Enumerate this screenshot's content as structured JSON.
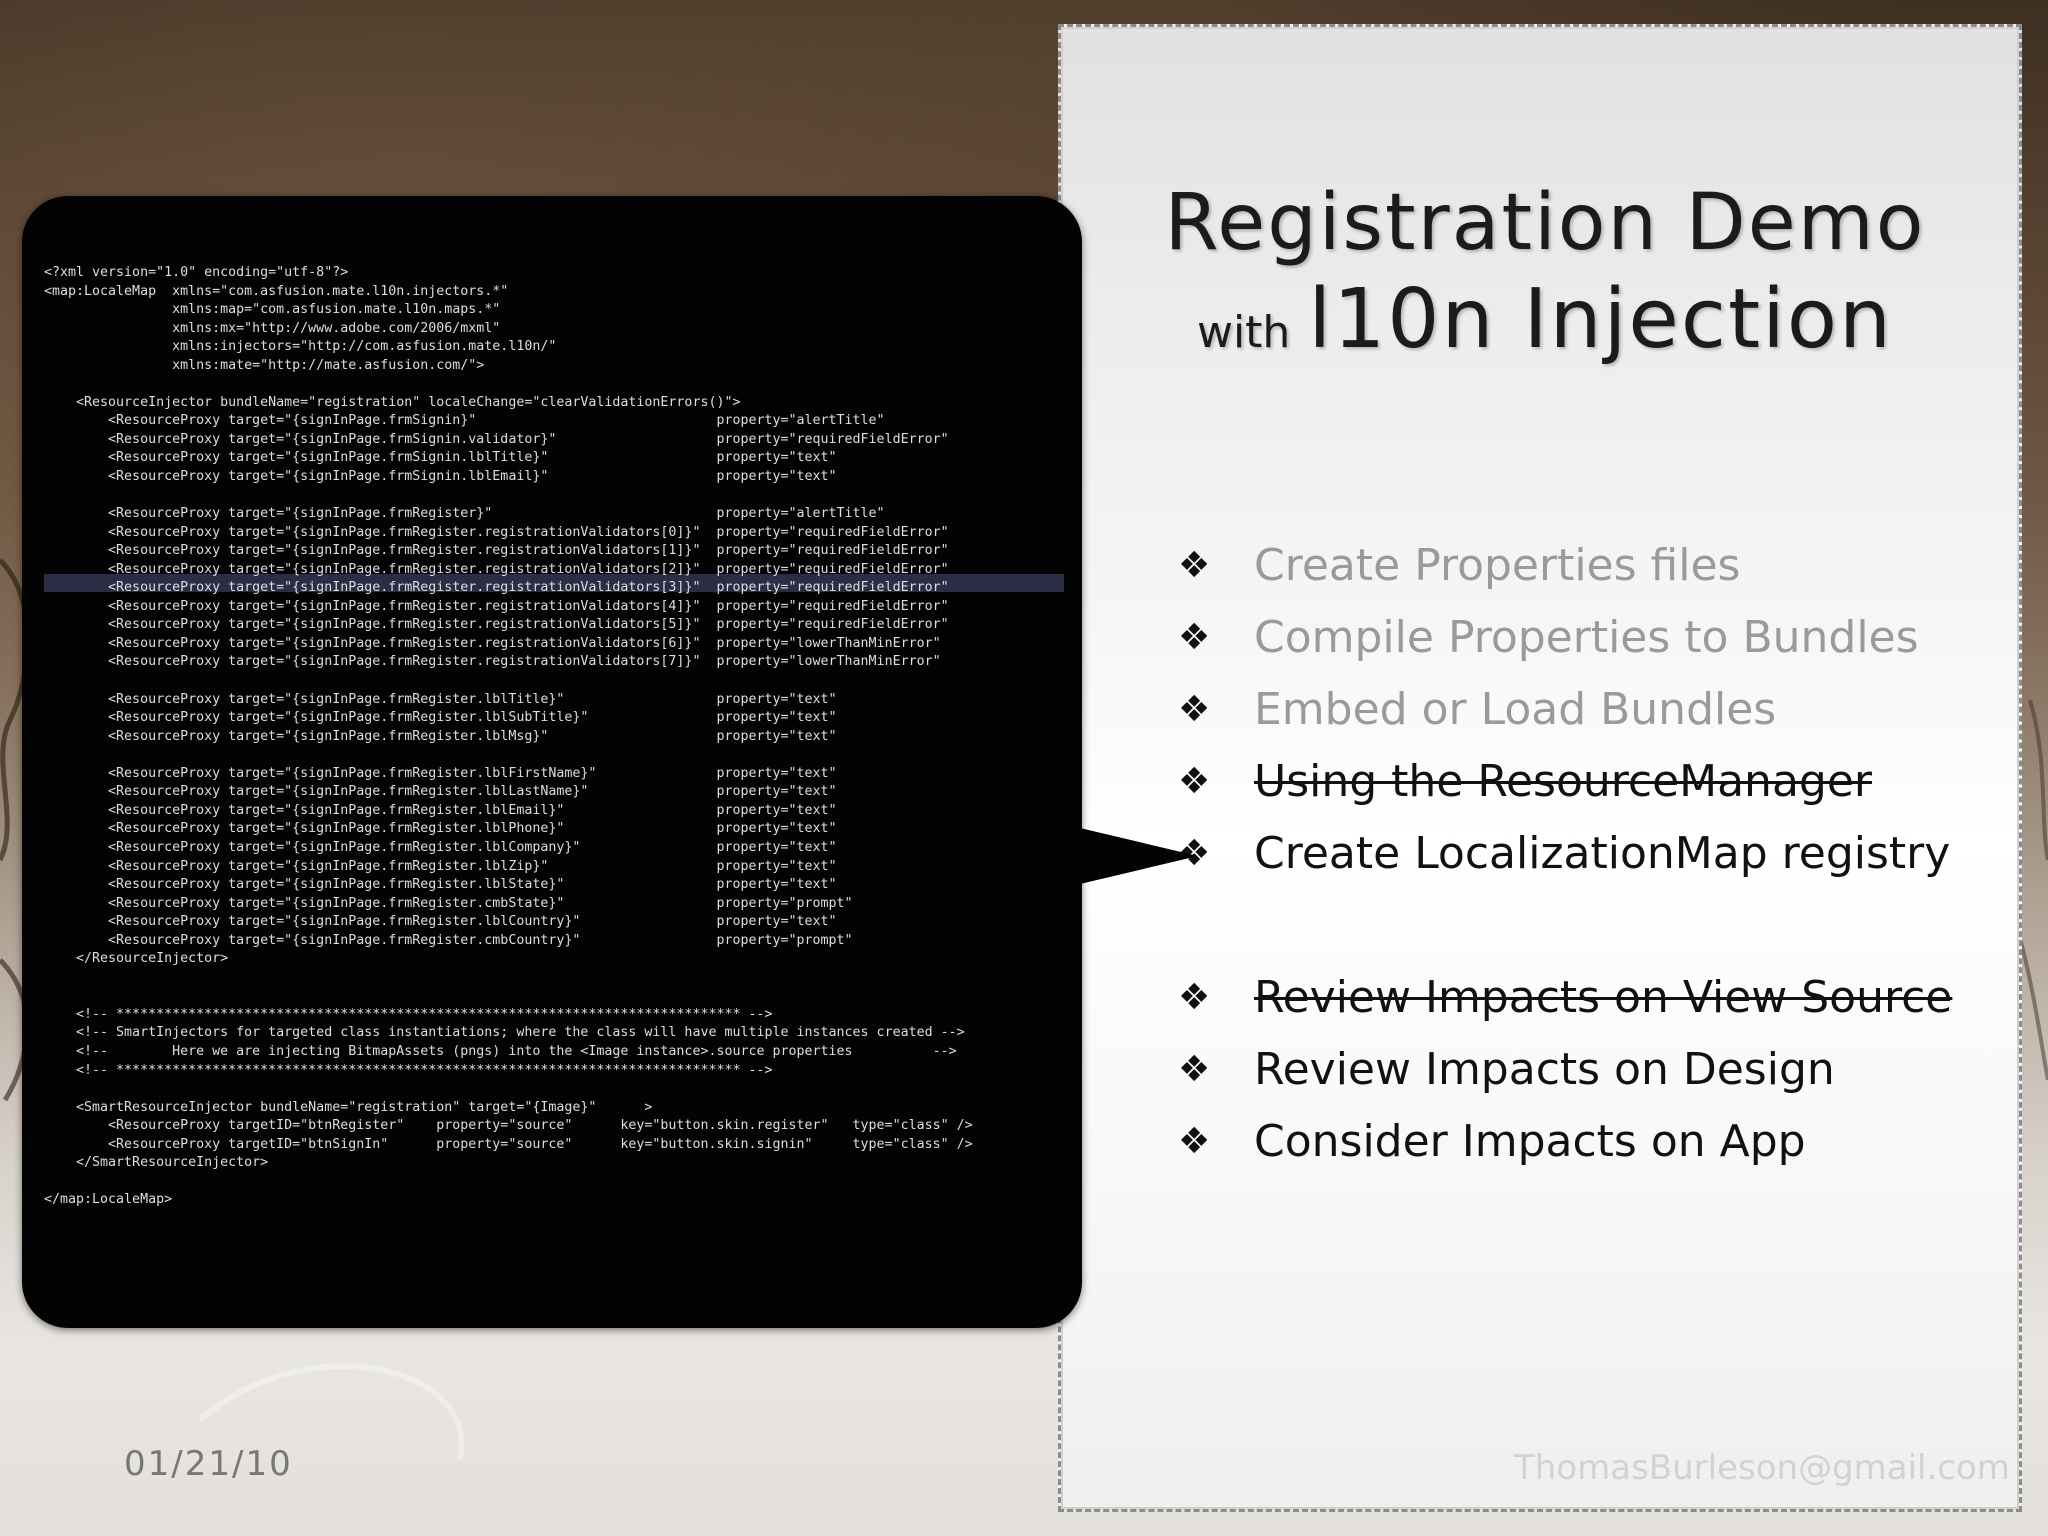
{
  "slide": {
    "title_line1": "Registration Demo",
    "title_with": "with",
    "title_main": "l10n Injection",
    "bullet_glyph": "❖",
    "bullets": [
      {
        "text": "Create Properties files",
        "state": "dim"
      },
      {
        "text": "Compile Properties to Bundles",
        "state": "dim"
      },
      {
        "text": "Embed or Load Bundles",
        "state": "dim"
      },
      {
        "text": "Using the ResourceManager",
        "state": "strikethrough"
      },
      {
        "text": "Create LocalizationMap registry",
        "state": "current"
      },
      {
        "text": "Review Impacts on View Source",
        "state": "strikethrough"
      },
      {
        "text": "Review Impacts on Design",
        "state": "normal"
      },
      {
        "text": "Consider Impacts on App",
        "state": "normal"
      }
    ],
    "date": "01/21/10",
    "email": "ThomasBurleson@gmail.com"
  },
  "code_lines": [
    "<?xml version=\"1.0\" encoding=\"utf-8\"?>",
    "<map:LocaleMap  xmlns=\"com.asfusion.mate.l10n.injectors.*\"",
    "                xmlns:map=\"com.asfusion.mate.l10n.maps.*\"",
    "                xmlns:mx=\"http://www.adobe.com/2006/mxml\"",
    "                xmlns:injectors=\"http://com.asfusion.mate.l10n/\"",
    "                xmlns:mate=\"http://mate.asfusion.com/\">",
    "",
    "    <ResourceInjector bundleName=\"registration\" localeChange=\"clearValidationErrors()\">",
    "        <ResourceProxy target=\"{signInPage.frmSignin}\"                              property=\"alertTitle\"",
    "        <ResourceProxy target=\"{signInPage.frmSignin.validator}\"                    property=\"requiredFieldError\"",
    "        <ResourceProxy target=\"{signInPage.frmSignin.lblTitle}\"                     property=\"text\"",
    "        <ResourceProxy target=\"{signInPage.frmSignin.lblEmail}\"                     property=\"text\"",
    "",
    "        <ResourceProxy target=\"{signInPage.frmRegister}\"                            property=\"alertTitle\"",
    "        <ResourceProxy target=\"{signInPage.frmRegister.registrationValidators[0]}\"  property=\"requiredFieldError\"",
    "        <ResourceProxy target=\"{signInPage.frmRegister.registrationValidators[1]}\"  property=\"requiredFieldError\"",
    "        <ResourceProxy target=\"{signInPage.frmRegister.registrationValidators[2]}\"  property=\"requiredFieldError\"",
    "        <ResourceProxy target=\"{signInPage.frmRegister.registrationValidators[3]}\"  property=\"requiredFieldError\"",
    "        <ResourceProxy target=\"{signInPage.frmRegister.registrationValidators[4]}\"  property=\"requiredFieldError\"",
    "        <ResourceProxy target=\"{signInPage.frmRegister.registrationValidators[5]}\"  property=\"requiredFieldError\"",
    "        <ResourceProxy target=\"{signInPage.frmRegister.registrationValidators[6]}\"  property=\"lowerThanMinError\"",
    "        <ResourceProxy target=\"{signInPage.frmRegister.registrationValidators[7]}\"  property=\"lowerThanMinError\"",
    "",
    "        <ResourceProxy target=\"{signInPage.frmRegister.lblTitle}\"                   property=\"text\"",
    "        <ResourceProxy target=\"{signInPage.frmRegister.lblSubTitle}\"                property=\"text\"",
    "        <ResourceProxy target=\"{signInPage.frmRegister.lblMsg}\"                     property=\"text\"",
    "",
    "        <ResourceProxy target=\"{signInPage.frmRegister.lblFirstName}\"               property=\"text\"",
    "        <ResourceProxy target=\"{signInPage.frmRegister.lblLastName}\"                property=\"text\"",
    "        <ResourceProxy target=\"{signInPage.frmRegister.lblEmail}\"                   property=\"text\"",
    "        <ResourceProxy target=\"{signInPage.frmRegister.lblPhone}\"                   property=\"text\"",
    "        <ResourceProxy target=\"{signInPage.frmRegister.lblCompany}\"                 property=\"text\"",
    "        <ResourceProxy target=\"{signInPage.frmRegister.lblZip}\"                     property=\"text\"",
    "        <ResourceProxy target=\"{signInPage.frmRegister.lblState}\"                   property=\"text\"",
    "        <ResourceProxy target=\"{signInPage.frmRegister.cmbState}\"                   property=\"prompt\"",
    "        <ResourceProxy target=\"{signInPage.frmRegister.lblCountry}\"                 property=\"text\"",
    "        <ResourceProxy target=\"{signInPage.frmRegister.cmbCountry}\"                 property=\"prompt\"",
    "    </ResourceInjector>",
    "",
    "",
    "    <!-- ****************************************************************************** -->",
    "    <!-- SmartInjectors for targeted class instantiations; where the class will have multiple instances created -->",
    "    <!--        Here we are injecting BitmapAssets (pngs) into the <Image instance>.source properties          -->",
    "    <!-- ****************************************************************************** -->",
    "",
    "    <SmartResourceInjector bundleName=\"registration\" target=\"{Image}\"      >",
    "        <ResourceProxy targetID=\"btnRegister\"    property=\"source\"      key=\"button.skin.register\"   type=\"class\" />",
    "        <ResourceProxy targetID=\"btnSignIn\"      property=\"source\"      key=\"button.skin.signin\"     type=\"class\" />",
    "    </SmartResourceInjector>",
    "",
    "</map:LocaleMap>"
  ]
}
